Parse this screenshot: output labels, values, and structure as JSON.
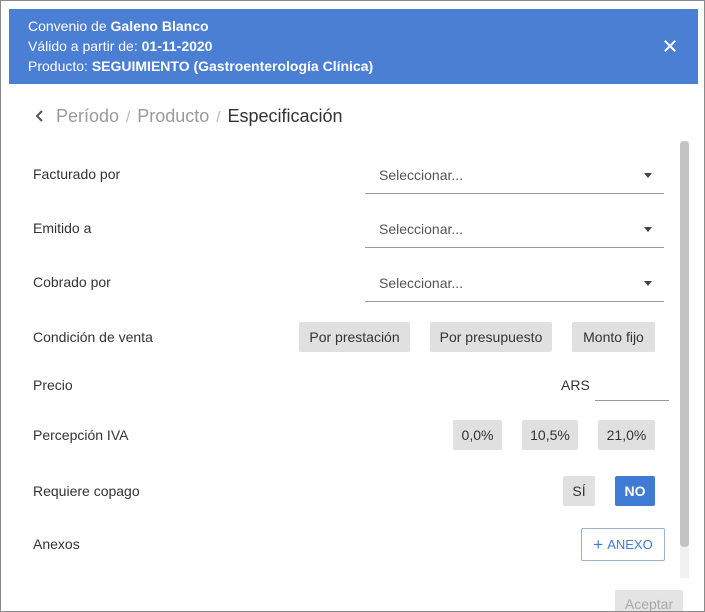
{
  "header": {
    "line1_prefix": "Convenio de",
    "line1_value": "Galeno Blanco",
    "line2_prefix": "Válido a partir de:",
    "line2_value": "01-11-2020",
    "line3_prefix": "Producto:",
    "line3_value": "SEGUIMIENTO (Gastroenterología Clínica)",
    "close_icon": "close-icon"
  },
  "breadcrumb": {
    "back_icon": "chevron-left-icon",
    "items": [
      "Período",
      "Producto",
      "Especificación"
    ],
    "separator": "/"
  },
  "form": {
    "facturado": {
      "label": "Facturado por",
      "placeholder": "Seleccionar..."
    },
    "emitido": {
      "label": "Emitido a",
      "placeholder": "Seleccionar..."
    },
    "cobrado": {
      "label": "Cobrado por",
      "placeholder": "Seleccionar..."
    },
    "condicion": {
      "label": "Condición de venta",
      "options": [
        "Por prestación",
        "Por presupuesto",
        "Monto fijo"
      ]
    },
    "precio": {
      "label": "Precio",
      "currency": "ARS",
      "value": ""
    },
    "iva": {
      "label": "Percepción IVA",
      "options": [
        "0,0%",
        "10,5%",
        "21,0%"
      ]
    },
    "copago": {
      "label": "Requiere copago",
      "options": [
        "SÍ",
        "NO"
      ],
      "selected": "NO"
    },
    "anexos": {
      "label": "Anexos",
      "button": "ANEXO",
      "button_icon": "plus-icon"
    }
  },
  "footer": {
    "accept_label": "Aceptar"
  },
  "colors": {
    "header_bg": "#4a7fd4",
    "accent": "#3f7ad4",
    "chip_bg": "#e0e0e0"
  }
}
